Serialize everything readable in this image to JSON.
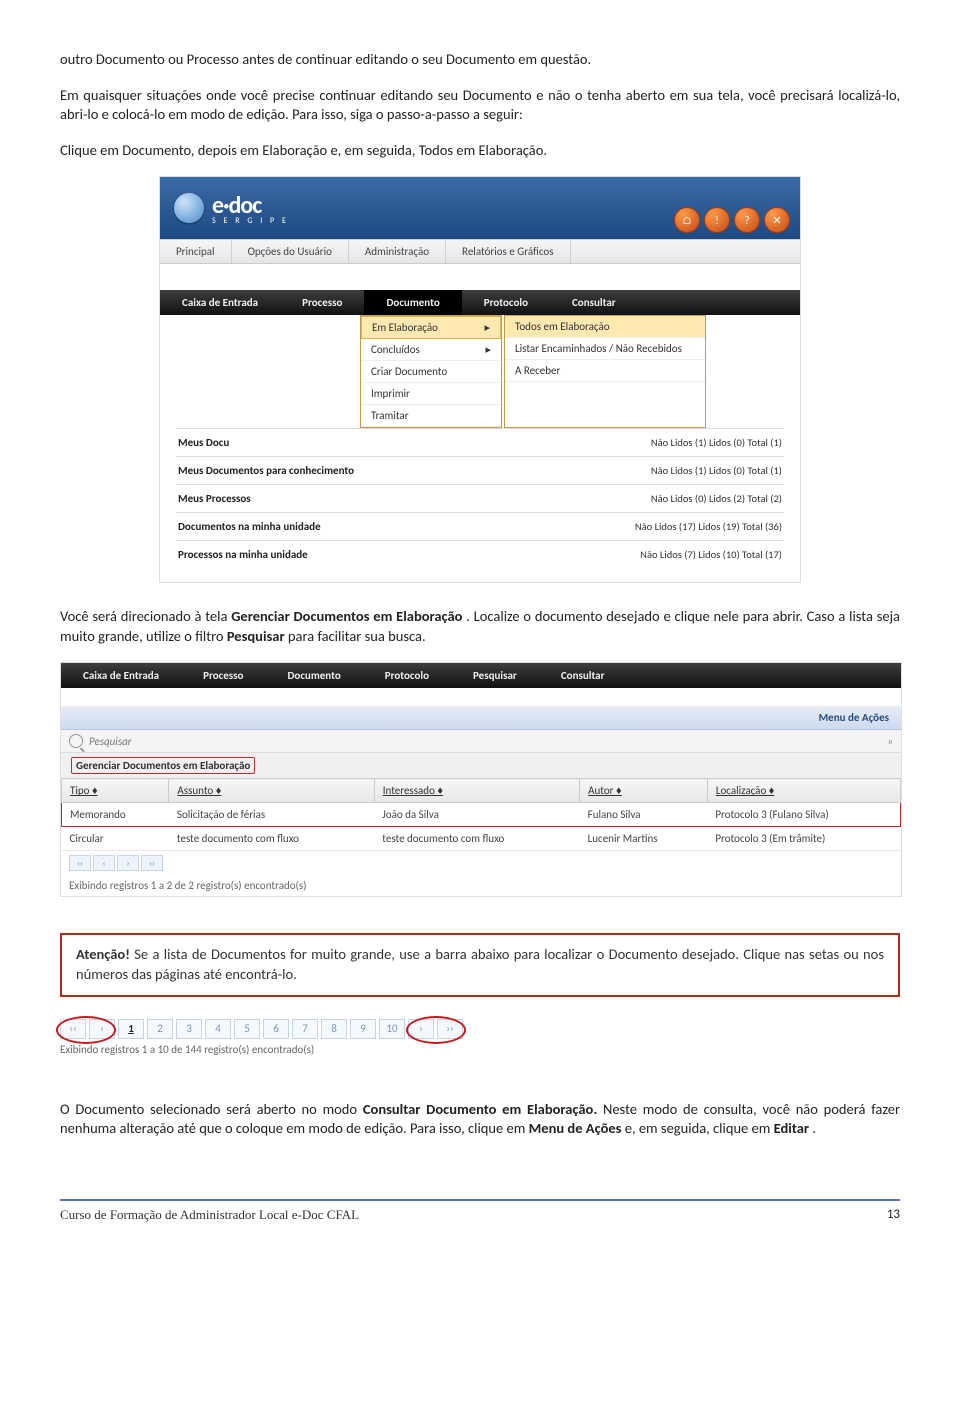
{
  "paragraphs": {
    "p1": "outro Documento ou Processo antes de continuar editando o seu Documento em questão.",
    "p2": "Em quaisquer situações onde você precise continuar editando seu Documento e não o tenha aberto em sua tela, você precisará localizá-lo, abri-lo e colocá-lo em modo de edição. Para isso, siga o passo-a-passo a seguir:",
    "p3": "Clique em Documento, depois em Elaboração e, em seguida, Todos em Elaboração.",
    "p4a": "Você será direcionado à tela ",
    "p4b": "Gerenciar Documentos em Elaboração",
    "p4c": ". Localize o documento desejado e clique nele para abrir. Caso a lista seja muito grande, utilize o filtro ",
    "p4d": "Pesquisar",
    "p4e": " para facilitar sua busca.",
    "warn_a": "Atenção!",
    "warn_b": " Se a lista de Documentos for muito grande, use a barra abaixo para localizar o Documento desejado. Clique nas setas ou nos números das páginas até encontrá-lo.",
    "p5a": "O Documento selecionado será aberto no modo ",
    "p5b": "Consultar Documento em Elaboração.",
    "p5c": " Neste modo de consulta, você não poderá fazer nenhuma alteração até que o coloque em modo de edição. Para isso, clique em ",
    "p5d": "Menu de Ações",
    "p5e": " e, em seguida, clique em ",
    "p5f": "Editar",
    "p5g": "."
  },
  "shot1": {
    "logo": "e·doc",
    "sergipe": "S E R G I P E",
    "topmenu": [
      "Principal",
      "Opções do Usuário",
      "Administração",
      "Relatórios e Gráficos"
    ],
    "round_btns": [
      "⌂",
      "!",
      "?",
      "✕"
    ],
    "submenu": [
      "Caixa de Entrada",
      "Processo",
      "Documento",
      "Protocolo",
      "Consultar"
    ],
    "ddcol1": [
      "Em Elaboração",
      "Concluídos",
      "Criar Documento",
      "Imprimir",
      "Tramitar"
    ],
    "ddcol2": [
      "Todos em Elaboração",
      "Listar Encaminhados / Não Recebidos",
      "A Receber"
    ],
    "inbox": [
      {
        "label": "Meus Docu",
        "counts": "Não Lidos (1)   Lidos (0)   Total (1)"
      },
      {
        "label": "Meus Documentos para conhecimento",
        "counts": "Não Lidos (1)   Lidos (0)   Total (1)"
      },
      {
        "label": "Meus Processos",
        "counts": "Não Lidos (0)   Lidos (2)   Total (2)"
      },
      {
        "label": "Documentos na minha unidade",
        "counts": "Não Lidos (17)   Lidos (19)   Total (36)"
      },
      {
        "label": "Processos na minha unidade",
        "counts": "Não Lidos (7)   Lidos (10)   Total (17)"
      }
    ]
  },
  "shot2": {
    "menu": [
      "Caixa de Entrada",
      "Processo",
      "Documento",
      "Protocolo",
      "Pesquisar",
      "Consultar"
    ],
    "menu_acoes": "Menu de Ações",
    "pesquisar": "Pesquisar",
    "gd_title": "Gerenciar Documentos em Elaboração",
    "headers": [
      "Tipo ♦",
      "Assunto ♦",
      "Interessado ♦",
      "Autor ♦",
      "Localização ♦"
    ],
    "rows": [
      [
        "Memorando",
        "Solicitação de férias",
        "João da Silva",
        "Fulano Silva",
        "Protocolo 3 (Fulano Silva)"
      ],
      [
        "Circular",
        "teste documento com fluxo",
        "teste documento com fluxo",
        "Lucenir Martins",
        "Protocolo 3 (Em trâmite)"
      ]
    ],
    "pager": [
      "‹‹",
      "‹",
      "›",
      "››"
    ],
    "exibindo": "Exibindo registros 1 a 2 de 2 registro(s) encontrado(s)"
  },
  "shot3": {
    "pages": [
      "‹‹",
      "‹",
      "1",
      "2",
      "3",
      "4",
      "5",
      "6",
      "7",
      "8",
      "9",
      "10",
      "›",
      "››"
    ],
    "exibindo": "Exibindo registros 1 a 10 de 144 registro(s) encontrado(s)"
  },
  "footer": {
    "left": "Curso de Formação de Administrador Local e-Doc CFAL",
    "page": "13"
  }
}
